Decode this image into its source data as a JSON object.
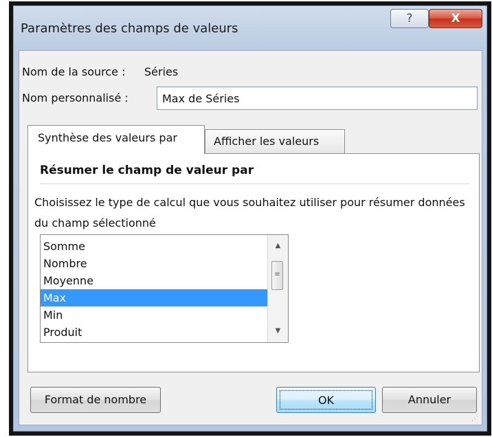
{
  "window": {
    "title": "Paramètres des champs de valeurs",
    "help_label": "?",
    "close_label": "X"
  },
  "source": {
    "label": "Nom de la source :",
    "value": "Séries"
  },
  "custom_name": {
    "label": "Nom personnalisé :",
    "value": "Max de Séries"
  },
  "tabs": [
    {
      "label": "Synthèse des valeurs par",
      "active": true
    },
    {
      "label": "Afficher les valeurs",
      "active": false
    }
  ],
  "panel": {
    "section_title": "Résumer le champ de valeur par",
    "description": "Choisissez le type de calcul que vous souhaitez utiliser pour résumer données du champ sélectionné"
  },
  "calc_list": {
    "items": [
      "Somme",
      "Nombre",
      "Moyenne",
      "Max",
      "Min",
      "Produit"
    ],
    "selected": "Max"
  },
  "scrollbar": {
    "up_arrow": "▲",
    "down_arrow": "▼",
    "thumb_grip": "≡"
  },
  "buttons": {
    "format": "Format de nombre",
    "ok": "OK",
    "cancel": "Annuler"
  },
  "colors": {
    "selection": "#3399ff",
    "close_button": "#c8301d",
    "title_bar": "#bccde3"
  }
}
